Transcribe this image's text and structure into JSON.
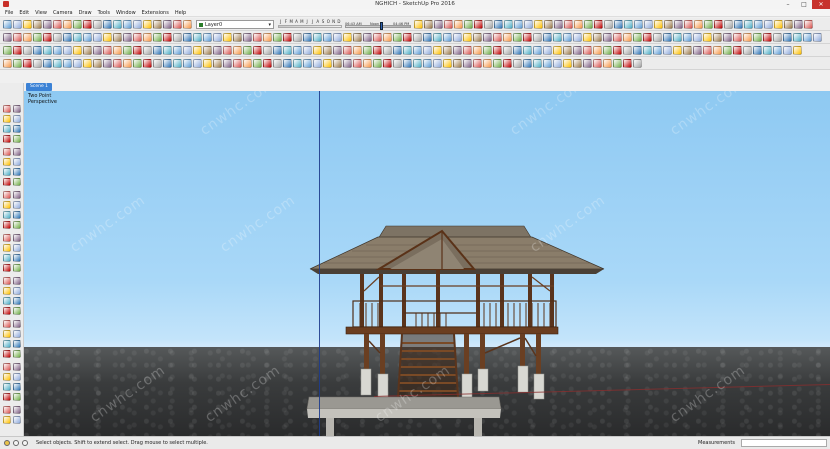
{
  "window": {
    "title": "NGHICH - SketchUp Pro 2016",
    "min_glyph": "–",
    "max_glyph": "□",
    "close_glyph": "✕"
  },
  "menu": [
    "File",
    "Edit",
    "View",
    "Camera",
    "Draw",
    "Tools",
    "Window",
    "Extensions",
    "Help"
  ],
  "toolbar": {
    "layer": "Layer0",
    "shadow_months": [
      "J",
      "F",
      "M",
      "A",
      "M",
      "J",
      "J",
      "A",
      "S",
      "O",
      "N",
      "D"
    ],
    "time_start": "06:43 AM",
    "time_noon": "Noon",
    "time_end": "04:46 PM"
  },
  "scene_tab": "Scene 1",
  "view_label": {
    "line1": "Two Point",
    "line2": "Perspective"
  },
  "watermark": "cnwhc.com",
  "statusbar": {
    "hint": "Select objects. Shift to extend select. Drag mouse to select multiple.",
    "measurements_label": "Measurements",
    "measurements_value": ""
  },
  "colors": {
    "sky_top": "#8ec9f2",
    "sky_horizon": "#cfe8fb",
    "ground": "#3a3c3d",
    "roof": "#8a7d6a",
    "wood": "#6a3f22",
    "scene_tab": "#3b82d6"
  }
}
